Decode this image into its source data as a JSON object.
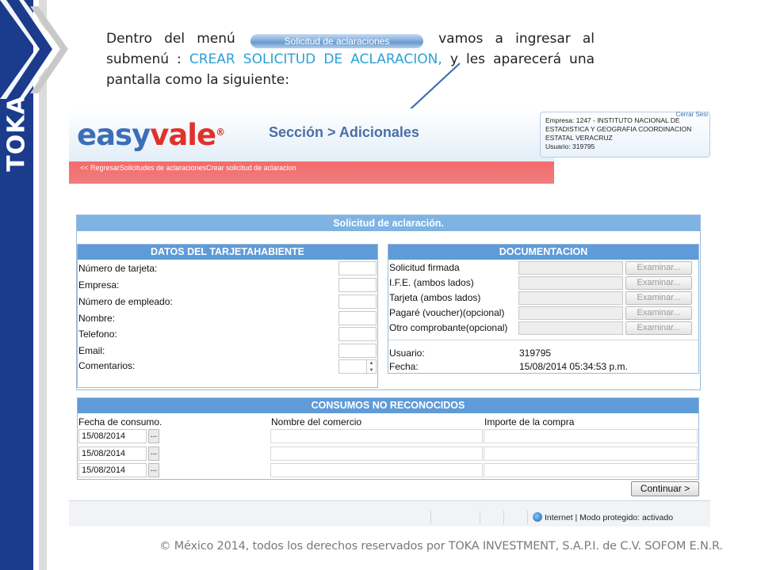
{
  "brand": {
    "logo_text": "TOKA",
    "bar_color": "#1b3b8c"
  },
  "intro": {
    "part1": "Dentro del menú",
    "menu_pill": "Solicitud de aclaraciones",
    "part2": "vamos a ingresar al submenú :",
    "highlight": "CREAR SOLICITUD DE ACLARACION,",
    "part3": "y les aparecerá una pantalla como la siguiente:",
    "highlight_color": "#2aa0d8"
  },
  "app": {
    "logo_easy": "easy",
    "logo_vale": "vale",
    "logo_reg": "®",
    "section_title": "Sección > Adicionales",
    "empresa_top": "Cerrar Sesi",
    "empresa_line1": "Empresa: 1247 - INSTITUTO NACIONAL DE",
    "empresa_line2": "ESTADISTICA Y GEOGRAFIA COORDINACION",
    "empresa_line3": "ESTATAL VERACRUZ",
    "empresa_user": "Usuario: 319795",
    "breadcrumb": "<< RegresarSolicitudes de aclaracionesCrear solicitud de aclaracion",
    "form_title": "Solicitud de aclaración.",
    "datos": {
      "title": "DATOS DEL TARJETAHABIENTE",
      "fields": [
        "Número de tarjeta:",
        "Empresa:",
        "Número de empleado:",
        "Nombre:",
        "Telefono:",
        "Email:",
        "Comentarios:"
      ]
    },
    "documentacion": {
      "title": "DOCUMENTACION",
      "items": [
        "Solicitud firmada",
        "I.F.E. (ambos lados)",
        "Tarjeta (ambos lados)",
        "Pagaré (voucher)(opcional)",
        "Otro comprobante(opcional)"
      ],
      "browse_label": "Examinar...",
      "usuario_label": "Usuario:",
      "usuario_value": "319795",
      "fecha_label": "Fecha:",
      "fecha_value": "15/08/2014 05:34:53 p.m."
    },
    "consumos": {
      "title": "CONSUMOS NO RECONOCIDOS",
      "col_fecha": "Fecha de consumo.",
      "col_comercio": "Nombre del comercio",
      "col_importe": "Importe de la compra",
      "dates": [
        "15/08/2014",
        "15/08/2014",
        "15/08/2014"
      ],
      "date_btn": "..."
    },
    "continue_label": "Continuar >",
    "status_text": "Internet | Modo protegido: activado"
  },
  "footer": "© México 2014, todos los derechos reservados por TOKA INVESTMENT, S.A.P.I. de C.V. SOFOM E.N.R."
}
